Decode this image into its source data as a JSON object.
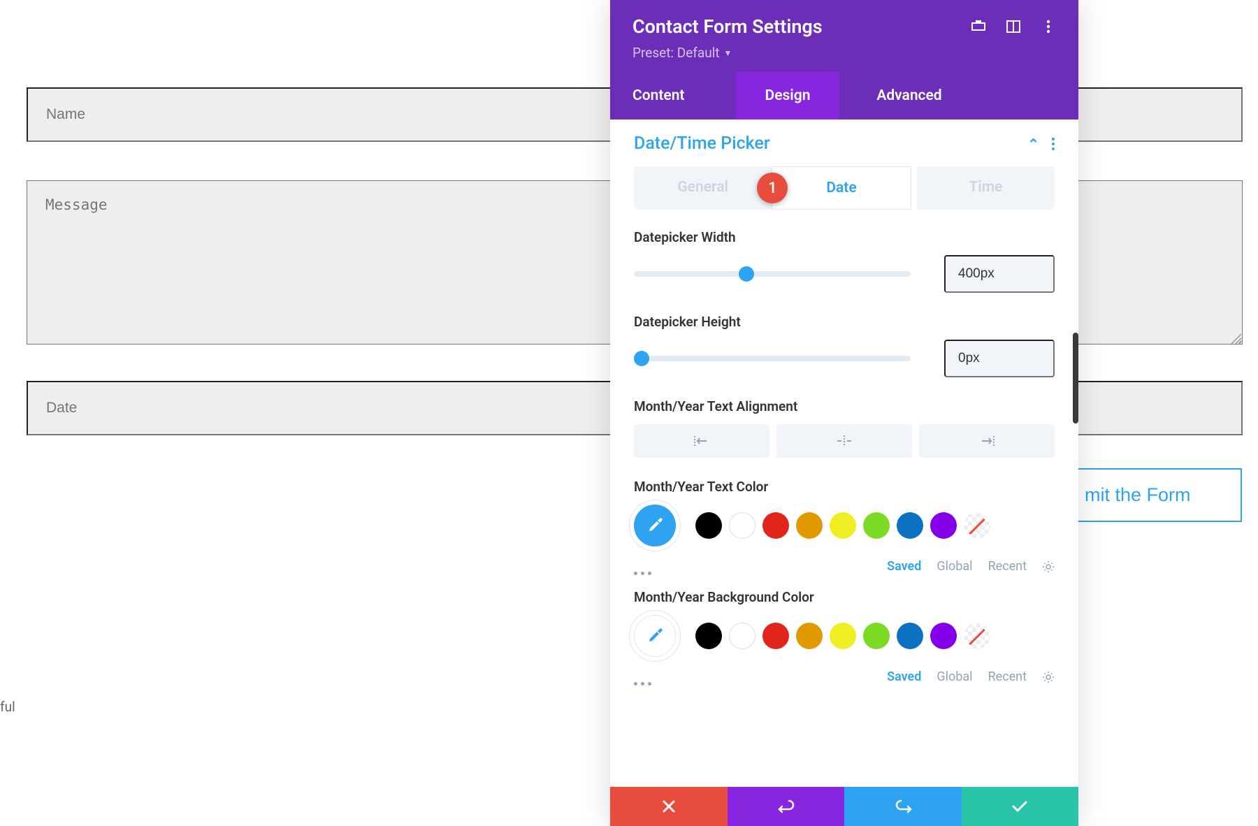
{
  "form": {
    "name_placeholder": "Name",
    "message_placeholder": "Message",
    "date_placeholder": "Date",
    "submit_label": "mit the Form"
  },
  "stray_text": "ful",
  "panel": {
    "title": "Contact Form Settings",
    "preset_label": "Preset: Default",
    "tabs": {
      "content": "Content",
      "design": "Design",
      "advanced": "Advanced"
    },
    "section": {
      "title": "Date/Time Picker",
      "subtabs": {
        "general": "General",
        "date": "Date",
        "time": "Time"
      },
      "badge": "1",
      "width_label": "Datepicker Width",
      "width_value": "400px",
      "width_percent": 38,
      "height_label": "Datepicker Height",
      "height_value": "0px",
      "height_percent": 0,
      "align_label": "Month/Year Text Alignment",
      "text_color_label": "Month/Year Text Color",
      "bg_color_label": "Month/Year Background Color",
      "color_tabs": {
        "saved": "Saved",
        "global": "Global",
        "recent": "Recent"
      },
      "swatches": [
        "#000000",
        "#ffffff",
        "#e0251b",
        "#e09900",
        "#eeee22",
        "#7cda24",
        "#0c71c3",
        "#8300e9"
      ]
    }
  }
}
